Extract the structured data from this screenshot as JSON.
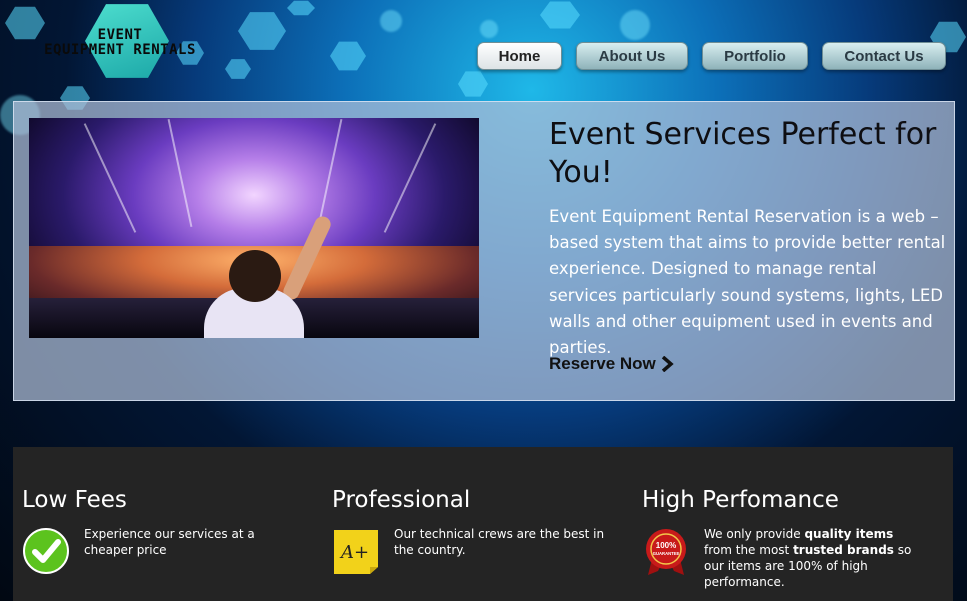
{
  "logo": {
    "line1": "EVENT",
    "line2": "EQUIPMENT RENTALS"
  },
  "nav": {
    "home": "Home",
    "about": "About Us",
    "portfolio": "Portfolio",
    "contact": "Contact Us",
    "active": "Home"
  },
  "hero": {
    "title": "Event Services Perfect for You!",
    "description": "Event Equipment Rental Reservation is a web – based system that aims to provide better rental experience. Designed to manage rental services particularly sound systems, lights, LED walls and other equipment used in events and parties.",
    "cta": "Reserve Now",
    "cta_icon": "chevron-right-icon"
  },
  "features": [
    {
      "title": "Low Fees",
      "icon": "checkmark-icon",
      "text": "Experience our services at a cheaper price"
    },
    {
      "title": "Professional",
      "icon": "a-plus-grade-icon",
      "text": "Our technical crews are the best in the country."
    },
    {
      "title": "High Perfomance",
      "icon": "guarantee-badge-icon",
      "text_parts": [
        "We only provide ",
        "quality items",
        " from the most ",
        "trusted brands",
        " so our items are 100% of high performance."
      ],
      "badge_text": "100%",
      "badge_sub": "GUARANTEE"
    }
  ],
  "colors": {
    "accent": "#1fb8e8",
    "dark_panel": "#242424",
    "check_green": "#5cc31e",
    "badge_red": "#c81a1a",
    "note_yellow": "#f2d21a"
  }
}
